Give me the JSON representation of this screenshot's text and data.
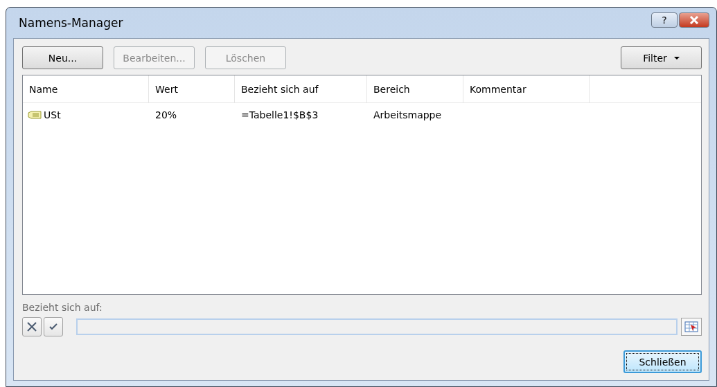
{
  "window": {
    "title": "Namens-Manager",
    "help": "?"
  },
  "toolbar": [
    {
      "label": "Neu...",
      "disabled": false
    },
    {
      "label": "Bearbeiten...",
      "disabled": true
    },
    {
      "label": "Löschen",
      "disabled": true
    }
  ],
  "filter": {
    "label": "Filter"
  },
  "table": {
    "columns": [
      "Name",
      "Wert",
      "Bezieht sich auf",
      "Bereich",
      "Kommentar"
    ],
    "rows": [
      {
        "selected": false,
        "cells": [
          "USt",
          "20%",
          "=Tabelle1!$B$3",
          "Arbeitsmappe",
          ""
        ]
      }
    ]
  },
  "refers_to": {
    "label": "Bezieht sich auf:"
  },
  "close_button": {
    "label": "Schließen"
  }
}
